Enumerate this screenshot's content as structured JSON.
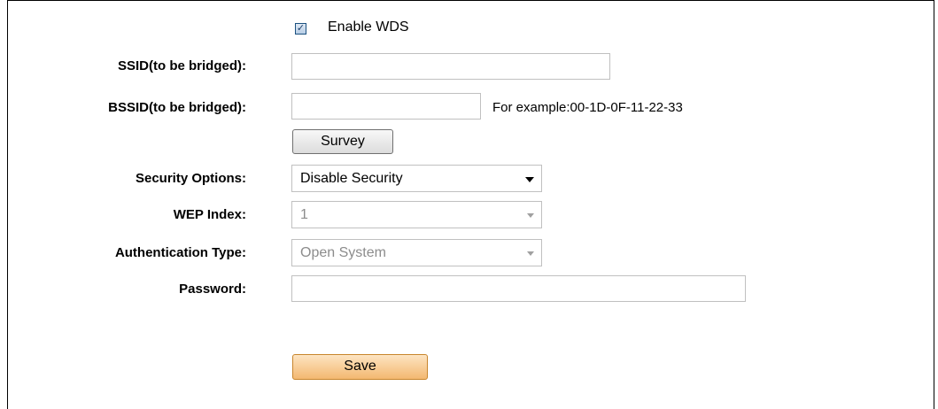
{
  "wds": {
    "checkbox_mark": "✓",
    "label": "Enable WDS",
    "checked": true
  },
  "fields": {
    "ssid_label": "SSID(to be bridged):",
    "ssid_value": "",
    "bssid_label": "BSSID(to be bridged):",
    "bssid_value": "",
    "bssid_hint": "For example:00-1D-0F-11-22-33",
    "survey_label": "Survey",
    "security_label": "Security Options:",
    "security_value": "Disable Security",
    "wep_label": "WEP Index:",
    "wep_value": "1",
    "auth_label": "Authentication Type:",
    "auth_value": "Open System",
    "password_label": "Password:",
    "password_value": ""
  },
  "actions": {
    "save_label": "Save"
  },
  "icons": {
    "dropdown": "chevron-down-icon",
    "checkbox": "check-icon"
  },
  "colors": {
    "save_button": "#f3b870",
    "border": "#c0c0c0",
    "disabled_text": "#8c8c8c"
  }
}
